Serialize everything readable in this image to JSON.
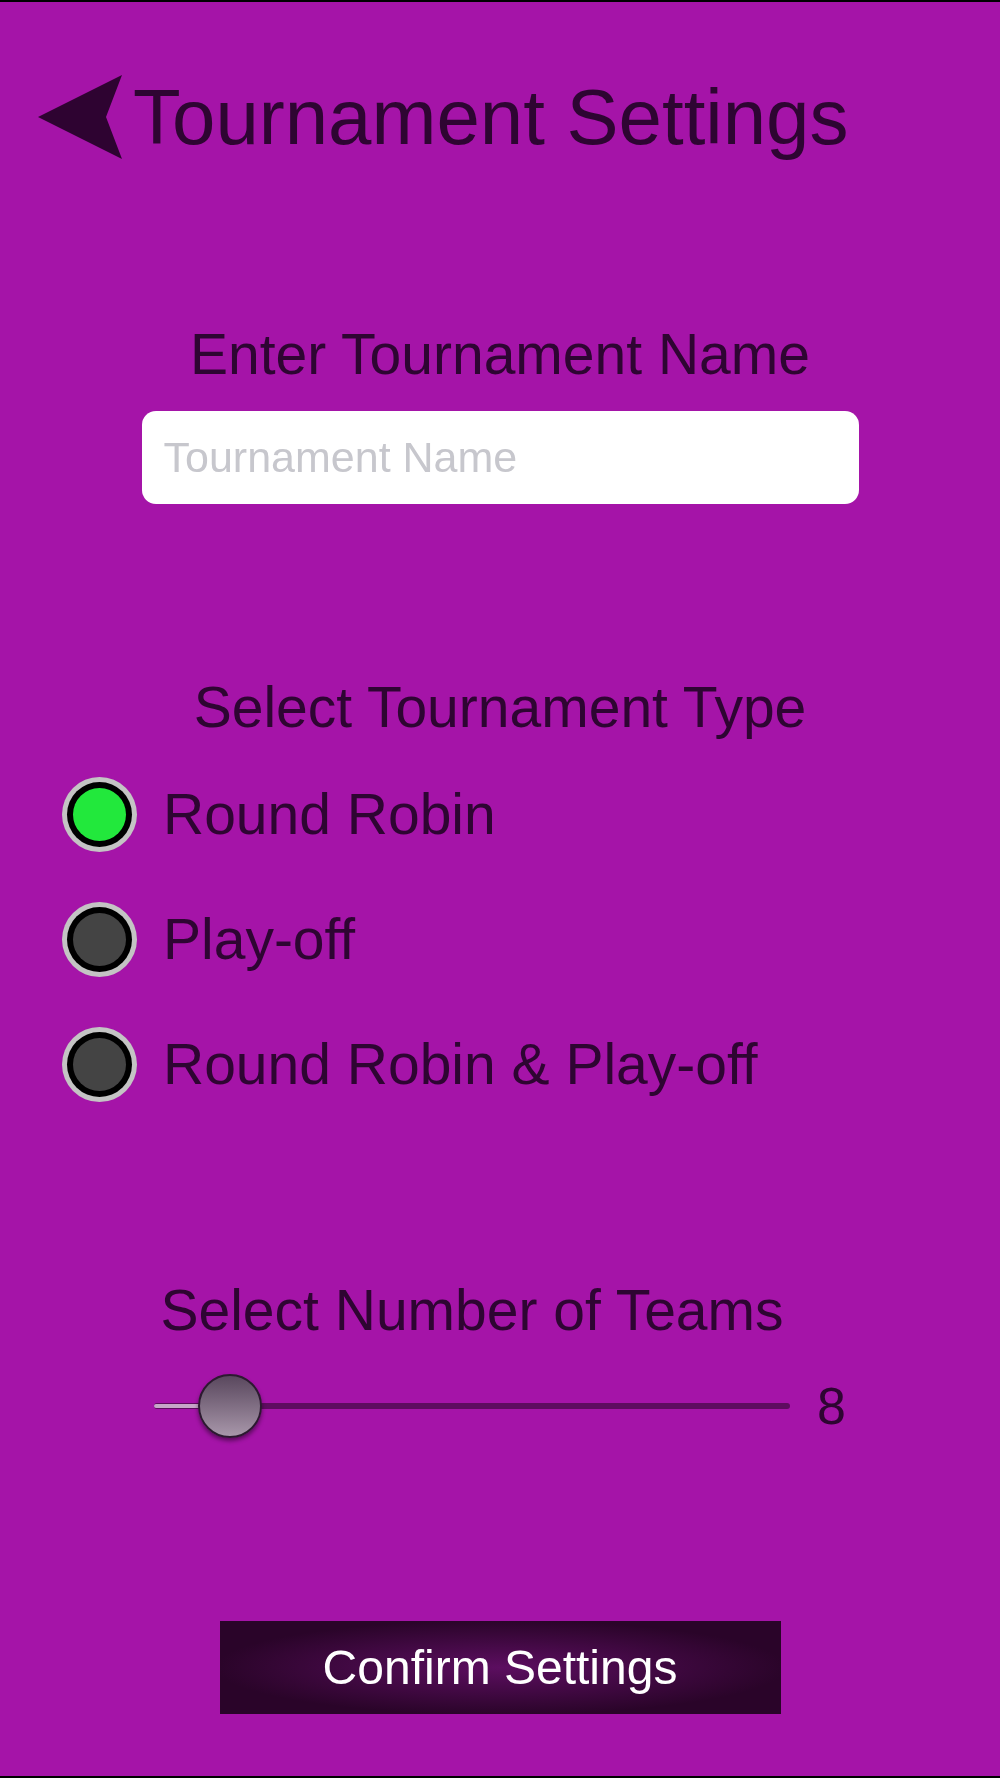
{
  "header": {
    "title": "Tournament Settings"
  },
  "name_section": {
    "label": "Enter Tournament Name",
    "field": {
      "placeholder": "Tournament Name"
    }
  },
  "type_section": {
    "label": "Select Tournament Type",
    "options": [
      {
        "label": "Round Robin",
        "selected": true
      },
      {
        "label": "Play-off",
        "selected": false
      },
      {
        "label": "Round Robin & Play-off",
        "selected": false
      }
    ]
  },
  "teams_section": {
    "label": "Select Number of Teams",
    "slider": {
      "level": 0.12
    },
    "reading": "8"
  },
  "confirm_button": {
    "label": "Confirm Settings"
  }
}
